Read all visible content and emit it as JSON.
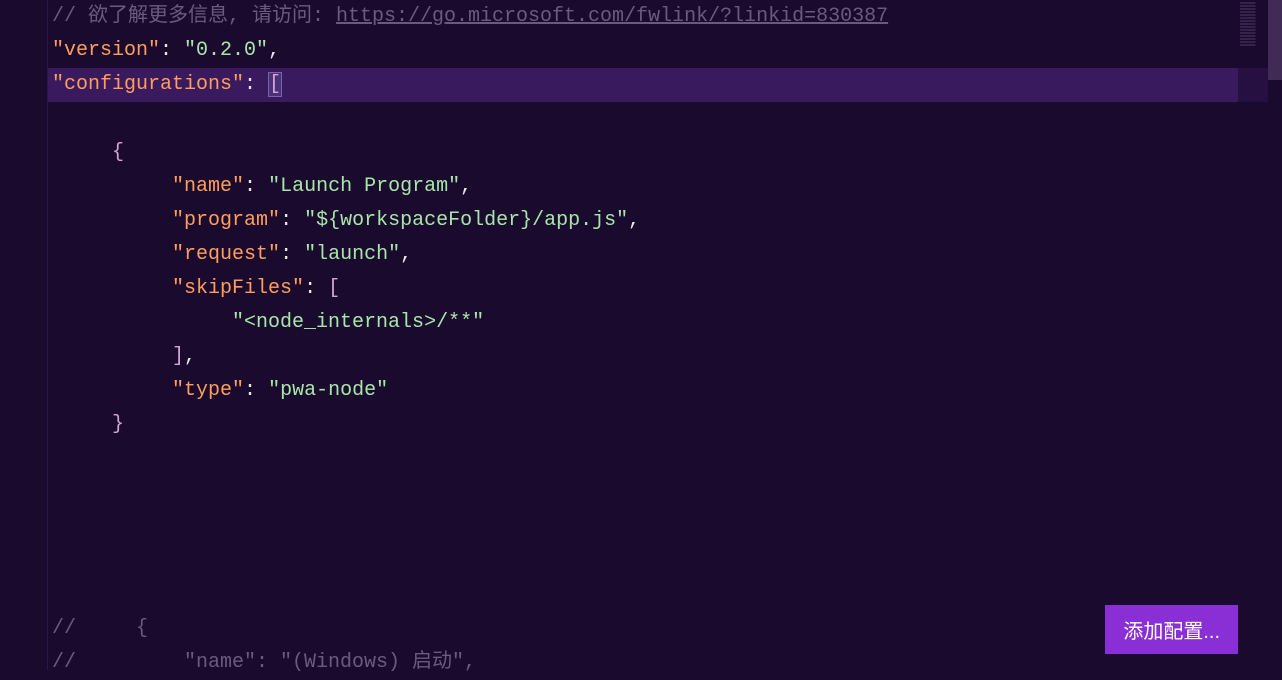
{
  "code": {
    "comment_prefix": "// 欲了解更多信息, 请访问: ",
    "comment_url": "https://go.microsoft.com/fwlink/?linkid=830387",
    "version_key": "\"version\"",
    "version_value": "\"0.2.0\"",
    "configurations_key": "\"configurations\"",
    "name_key": "\"name\"",
    "name_value": "\"Launch Program\"",
    "program_key": "\"program\"",
    "program_value": "\"${workspaceFolder}/app.js\"",
    "request_key": "\"request\"",
    "request_value": "\"launch\"",
    "skipfiles_key": "\"skipFiles\"",
    "skipfiles_value": "\"<node_internals>/**\"",
    "type_key": "\"type\"",
    "type_value": "\"pwa-node\"",
    "comment_brace": "//     {",
    "comment_name_line": "//         \"name\": \"(Windows) 启动\","
  },
  "button": {
    "add_config": "添加配置..."
  },
  "colors": {
    "background": "#1a0b2e",
    "highlight": "#3a1a5e",
    "key": "#ff9d5c",
    "string": "#a8e6a8",
    "comment": "#6b5a7e",
    "button": "#8a2ed6"
  }
}
